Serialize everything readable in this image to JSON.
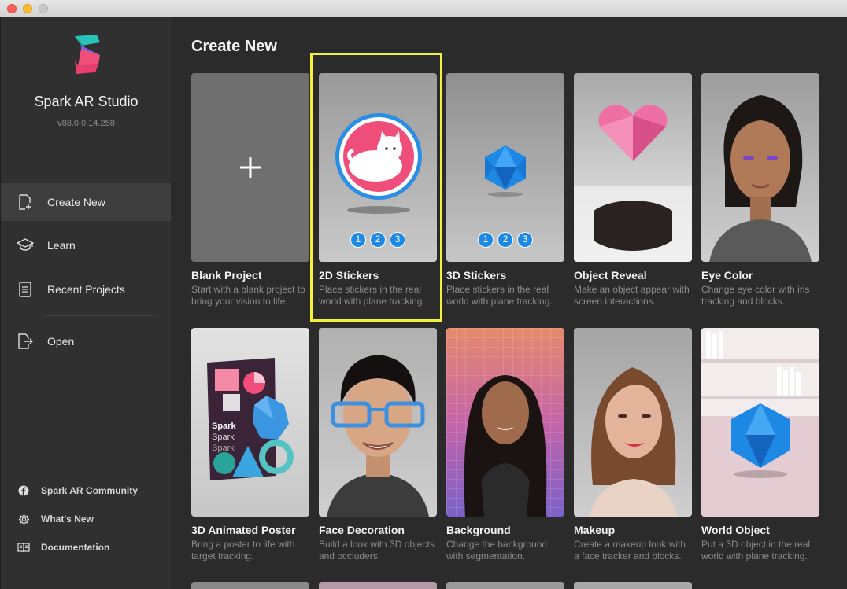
{
  "app": {
    "name": "Spark AR Studio",
    "version": "v88.0.0.14.258",
    "brand_colors": [
      "#2ac3b9",
      "#f04e7a",
      "#7a5af0"
    ]
  },
  "sidebar": {
    "items": [
      {
        "label": "Create New",
        "icon": "new-file-icon",
        "active": true
      },
      {
        "label": "Learn",
        "icon": "graduation-cap-icon",
        "active": false
      },
      {
        "label": "Recent Projects",
        "icon": "document-icon",
        "active": false
      },
      {
        "label": "Open",
        "icon": "open-file-icon",
        "active": false
      }
    ],
    "footer": [
      {
        "label": "Spark AR Community",
        "icon": "facebook-icon"
      },
      {
        "label": "What's New",
        "icon": "gear-icon"
      },
      {
        "label": "Documentation",
        "icon": "book-icon"
      }
    ]
  },
  "main": {
    "title": "Create New",
    "highlight_color": "#f4ef37",
    "templates": [
      {
        "title": "Blank Project",
        "desc": "Start with a blank project to bring your vision to life.",
        "thumb": "plus-icon"
      },
      {
        "title": "2D Stickers",
        "desc": "Place stickers in the real world with plane tracking.",
        "thumb": "sticker-steps",
        "steps": [
          "1",
          "2",
          "3"
        ],
        "highlighted": true
      },
      {
        "title": "3D Stickers",
        "desc": "Place stickers in the real world with plane tracking.",
        "thumb": "icosahedron-steps",
        "steps": [
          "1",
          "2",
          "3"
        ]
      },
      {
        "title": "Object Reveal",
        "desc": "Make an object appear with screen interactions.",
        "thumb": "heart-hole"
      },
      {
        "title": "Eye Color",
        "desc": "Change eye color with iris tracking and blocks.",
        "thumb": "face-portrait"
      },
      {
        "title": "3D Animated Poster",
        "desc": "Bring a poster to life with target tracking.",
        "thumb": "poster",
        "poster_words": [
          "Spark",
          "Spark",
          "Spark"
        ]
      },
      {
        "title": "Face Decoration",
        "desc": "Build a look with 3D objects and occluders.",
        "thumb": "face-glasses"
      },
      {
        "title": "Background",
        "desc": "Change the background with segmentation.",
        "thumb": "face-background"
      },
      {
        "title": "Makeup",
        "desc": "Create a makeup look with a face tracker and blocks.",
        "thumb": "face-makeup"
      },
      {
        "title": "World Object",
        "desc": "Put a 3D object in the real world with plane tracking.",
        "thumb": "icosahedron-room"
      }
    ]
  }
}
